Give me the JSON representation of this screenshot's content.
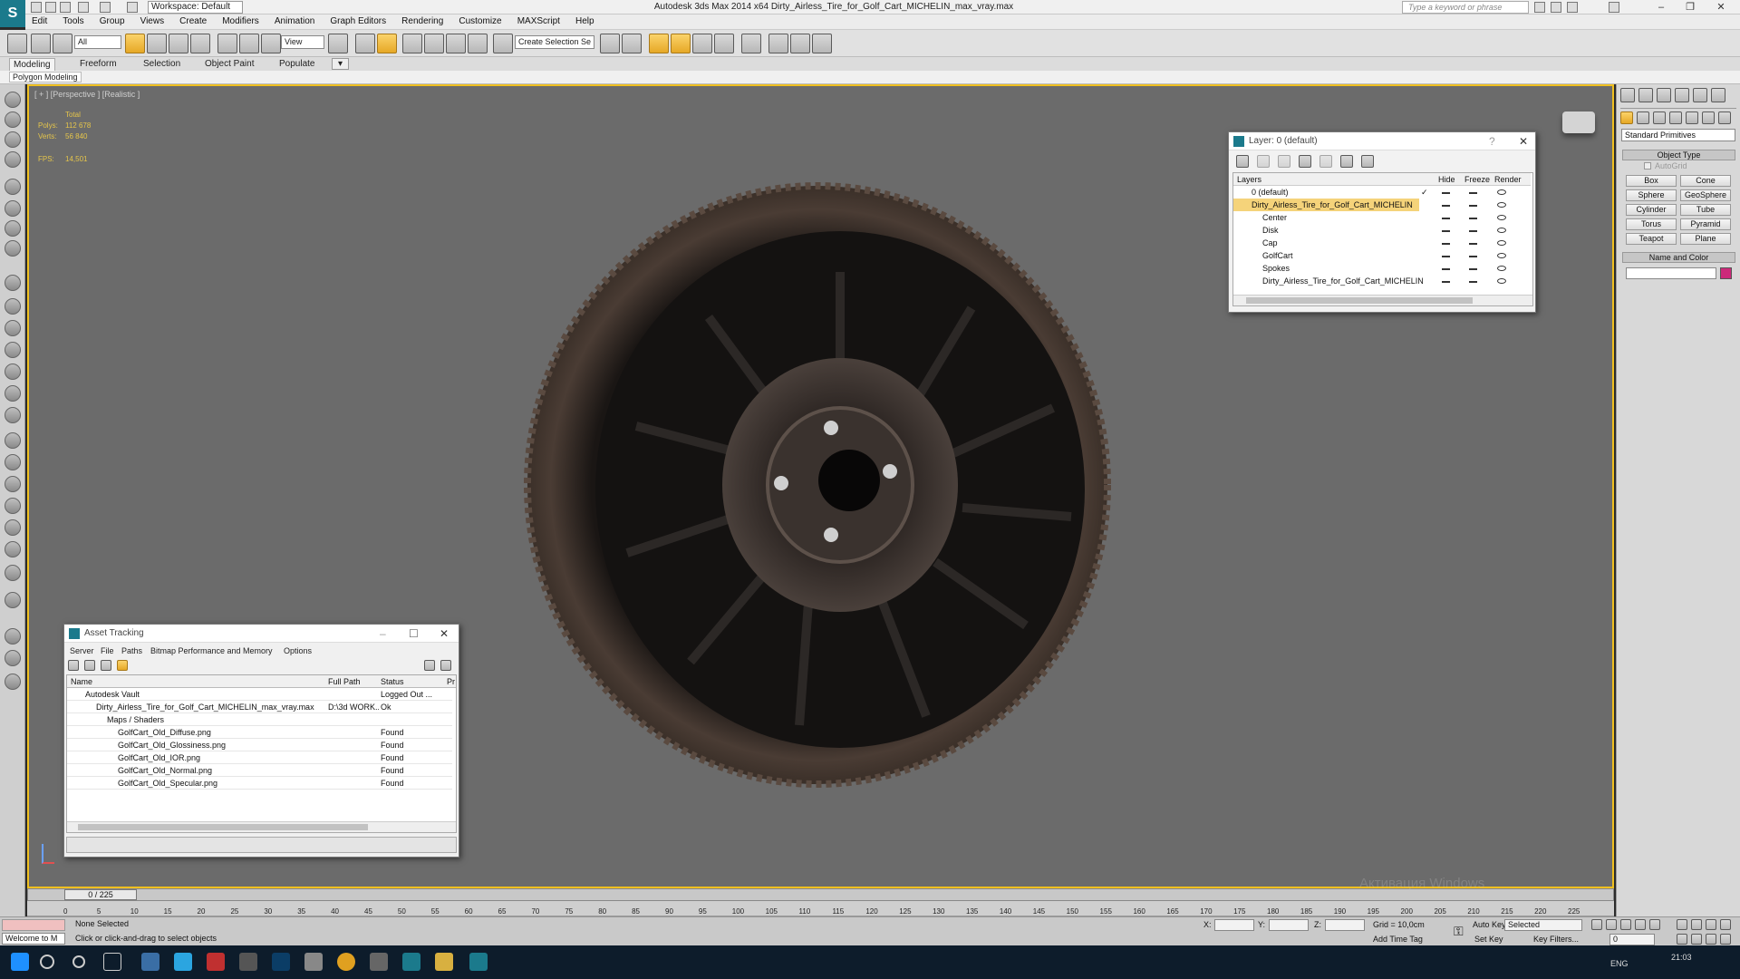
{
  "titlebar": {
    "title": "Autodesk 3ds Max  2014 x64    Dirty_Airless_Tire_for_Golf_Cart_MICHELIN_max_vray.max",
    "workspace": "Workspace: Default",
    "search_placeholder": "Type a keyword or phrase",
    "app_logo": "S"
  },
  "menu": [
    "Edit",
    "Tools",
    "Group",
    "Views",
    "Create",
    "Modifiers",
    "Animation",
    "Graph Editors",
    "Rendering",
    "Customize",
    "MAXScript",
    "Help"
  ],
  "toolbar": {
    "selection_filter": "All",
    "ref_coord": "View",
    "named_selection": "Create Selection Se"
  },
  "ribbon": {
    "tabs": [
      "Modeling",
      "Freeform",
      "Selection",
      "Object Paint",
      "Populate"
    ],
    "active_tab": "Modeling",
    "sub_label": "Polygon Modeling"
  },
  "viewport": {
    "label": "[ + ] [Perspective ] [Realistic ]",
    "stats_header": "Total",
    "polys_label": "Polys:",
    "polys_value": "112 678",
    "verts_label": "Verts:",
    "verts_value": "56 840",
    "fps_label": "FPS:",
    "fps_value": "14,501"
  },
  "layer_dialog": {
    "title": "Layer: 0 (default)",
    "help": "?",
    "columns": [
      "Layers",
      "Hide",
      "Freeze",
      "Render"
    ],
    "rows": [
      {
        "name": "0 (default)",
        "check": "✓"
      },
      {
        "name": "Dirty_Airless_Tire_for_Golf_Cart_MICHELIN"
      },
      {
        "name": "Center"
      },
      {
        "name": "Disk"
      },
      {
        "name": "Cap"
      },
      {
        "name": "GolfCart"
      },
      {
        "name": "Spokes"
      },
      {
        "name": "Dirty_Airless_Tire_for_Golf_Cart_MICHELIN"
      }
    ]
  },
  "asset_tracking": {
    "title": "Asset Tracking",
    "menus": [
      "Server",
      "File",
      "Paths",
      "Bitmap Performance and Memory",
      "Options"
    ],
    "columns": [
      "Name",
      "Full Path",
      "Status",
      "Pr"
    ],
    "rows": [
      {
        "name": "Autodesk Vault",
        "path": "",
        "status": "Logged Out ..."
      },
      {
        "name": "Dirty_Airless_Tire_for_Golf_Cart_MICHELIN_max_vray.max",
        "path": "D:\\3d WORK...",
        "status": "Ok"
      },
      {
        "name": "Maps / Shaders",
        "path": "",
        "status": ""
      },
      {
        "name": "GolfCart_Old_Diffuse.png",
        "path": "",
        "status": "Found"
      },
      {
        "name": "GolfCart_Old_Glossiness.png",
        "path": "",
        "status": "Found"
      },
      {
        "name": "GolfCart_Old_IOR.png",
        "path": "",
        "status": "Found"
      },
      {
        "name": "GolfCart_Old_Normal.png",
        "path": "",
        "status": "Found"
      },
      {
        "name": "GolfCart_Old_Specular.png",
        "path": "",
        "status": "Found"
      }
    ]
  },
  "command_panel": {
    "category": "Standard Primitives",
    "object_type_header": "Object Type",
    "autogrid": "AutoGrid",
    "buttons": [
      "Box",
      "Cone",
      "Sphere",
      "GeoSphere",
      "Cylinder",
      "Tube",
      "Torus",
      "Pyramid",
      "Teapot",
      "Plane"
    ],
    "name_color_header": "Name and Color",
    "color": "#cc2a7a"
  },
  "timeline": {
    "frame": "0 / 225",
    "ticks": [
      "0",
      "5",
      "10",
      "15",
      "20",
      "25",
      "30",
      "35",
      "40",
      "45",
      "50",
      "55",
      "60",
      "65",
      "70",
      "75",
      "80",
      "85",
      "90",
      "95",
      "100",
      "105",
      "110",
      "115",
      "120",
      "125",
      "130",
      "135",
      "140",
      "145",
      "150",
      "155",
      "160",
      "165",
      "170",
      "175",
      "180",
      "185",
      "190",
      "195",
      "200",
      "205",
      "210",
      "215",
      "220",
      "225"
    ]
  },
  "status_bar": {
    "selection": "None Selected",
    "prompt": "Click or click-and-drag to select objects",
    "maxscript": "Welcome to M",
    "x_label": "X:",
    "y_label": "Y:",
    "z_label": "Z:",
    "grid": "Grid = 10,0cm",
    "add_time_tag": "Add Time Tag",
    "auto_key": "Auto Key",
    "set_key": "Set Key",
    "selected": "Selected",
    "key_filters": "Key Filters...",
    "frame_field": "0"
  },
  "taskbar": {
    "time": "21:03",
    "lang": "ENG"
  },
  "watermark": "Активация Windows"
}
